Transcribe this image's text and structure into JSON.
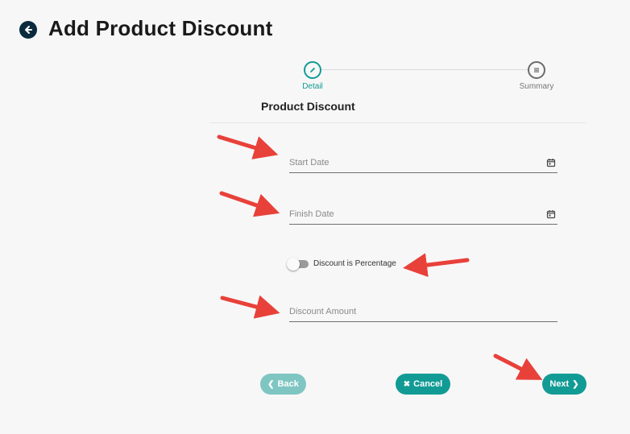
{
  "header": {
    "title": "Add Product Discount",
    "back_icon": "arrow-left-icon"
  },
  "stepper": {
    "steps": [
      {
        "label": "Detail",
        "icon": "pencil-icon",
        "state": "active"
      },
      {
        "label": "Summary",
        "icon": "list-icon",
        "state": "inactive"
      }
    ]
  },
  "form": {
    "section_title": "Product Discount",
    "start_date": {
      "placeholder": "Start Date",
      "value": ""
    },
    "finish_date": {
      "placeholder": "Finish Date",
      "value": ""
    },
    "percentage_toggle": {
      "label": "Discount is Percentage",
      "checked": false
    },
    "discount_amount": {
      "placeholder": "Discount Amount",
      "value": ""
    }
  },
  "buttons": {
    "back": "Back",
    "cancel": "Cancel",
    "next": "Next"
  },
  "colors": {
    "accent": "#129b95",
    "accent_light": "#7fc6c3",
    "header_icon": "#0b2a3d",
    "annotation_arrow": "#e8413a"
  }
}
